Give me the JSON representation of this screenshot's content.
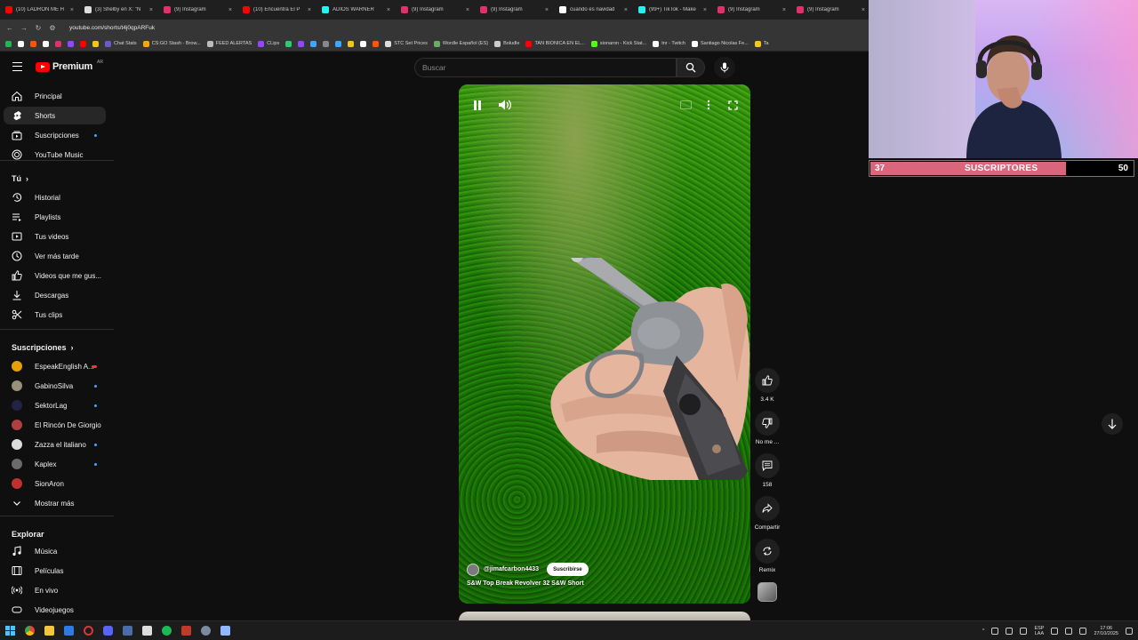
{
  "browser": {
    "tabs": [
      {
        "title": "(10) LADRÓN ME H",
        "color": "#ff0000",
        "active": false
      },
      {
        "title": "(3) Shelby en X: \"N",
        "color": "#dddddd",
        "active": false
      },
      {
        "title": "(9) Instagram",
        "color": "#e1306c",
        "active": false
      },
      {
        "title": "(10) Encuentra El P",
        "color": "#ff0000",
        "active": false
      },
      {
        "title": "ADIOS WARNER",
        "color": "#25f4ee",
        "active": false
      },
      {
        "title": "(9) Instagram",
        "color": "#e1306c",
        "active": false
      },
      {
        "title": "(9) Instagram",
        "color": "#e1306c",
        "active": false
      },
      {
        "title": "cuando es navidad",
        "color": "#ffffff",
        "active": false
      },
      {
        "title": "(99+) TikTok - Make",
        "color": "#25f4ee",
        "active": false
      },
      {
        "title": "(9) Instagram",
        "color": "#e1306c",
        "active": false
      },
      {
        "title": "(9) Instagram",
        "color": "#e1306c",
        "active": false
      }
    ],
    "url": "youtube.com/shorts/t4j0qpARFuk",
    "bookmarks": [
      {
        "label": "",
        "color": "#1db954"
      },
      {
        "label": "",
        "color": "#ffffff"
      },
      {
        "label": "",
        "color": "#ff5500"
      },
      {
        "label": "",
        "color": "#ffffff"
      },
      {
        "label": "",
        "color": "#e1306c"
      },
      {
        "label": "",
        "color": "#9146ff"
      },
      {
        "label": "",
        "color": "#ff0000"
      },
      {
        "label": "",
        "color": "#f5c518"
      },
      {
        "label": "Chat Stats",
        "color": "#6a5acd"
      },
      {
        "label": "CS:GO Stash - Brow...",
        "color": "#ffa500"
      },
      {
        "label": "FEED ALERTAS",
        "color": "#bbbbbb"
      },
      {
        "label": "CLips",
        "color": "#9146ff"
      },
      {
        "label": "",
        "color": "#2ecc71"
      },
      {
        "label": "",
        "color": "#9146ff"
      },
      {
        "label": "",
        "color": "#3ea6ff"
      },
      {
        "label": "",
        "color": "#888888"
      },
      {
        "label": "",
        "color": "#3ea6ff"
      },
      {
        "label": "",
        "color": "#f5c518"
      },
      {
        "label": "",
        "color": "#ffffff"
      },
      {
        "label": "",
        "color": "#ff5500"
      },
      {
        "label": "STC Set Prices",
        "color": "#dddddd"
      },
      {
        "label": "Wordle Español (ES)",
        "color": "#6aaa64"
      },
      {
        "label": "Boludle",
        "color": "#cccccc"
      },
      {
        "label": "TAN BIONICA EN EL...",
        "color": "#ff0000"
      },
      {
        "label": "sionaron - Kick Stat...",
        "color": "#53fc18"
      },
      {
        "label": "tnr - Twitch",
        "color": "#ffffff"
      },
      {
        "label": "Santiago Nicolas Fe...",
        "color": "#ffffff"
      },
      {
        "label": "Ta",
        "color": "#f5c518"
      }
    ]
  },
  "youtube": {
    "logo_text": "Premium",
    "logo_country": "AR",
    "search_placeholder": "Buscar",
    "sidebar": {
      "main": [
        {
          "label": "Principal",
          "icon": "home-icon",
          "active": false
        },
        {
          "label": "Shorts",
          "icon": "shorts-icon",
          "active": true
        },
        {
          "label": "Suscripciones",
          "icon": "subscriptions-icon",
          "active": false,
          "dot": true
        },
        {
          "label": "YouTube Music",
          "icon": "music-icon",
          "active": false
        }
      ],
      "you_heading": "Tú",
      "you": [
        {
          "label": "Historial",
          "icon": "history-icon"
        },
        {
          "label": "Playlists",
          "icon": "playlist-icon"
        },
        {
          "label": "Tus videos",
          "icon": "video-icon"
        },
        {
          "label": "Ver más tarde",
          "icon": "clock-icon"
        },
        {
          "label": "Videos que me gus...",
          "icon": "like-icon"
        },
        {
          "label": "Descargas",
          "icon": "download-icon"
        },
        {
          "label": "Tus clips",
          "icon": "scissors-icon"
        }
      ],
      "subs_heading": "Suscripciones",
      "subs": [
        {
          "label": "EspeakEnglish A...",
          "color": "#e3a008",
          "badge": "live"
        },
        {
          "label": "GabinoSilva",
          "color": "#9a8f7a",
          "badge": "dot"
        },
        {
          "label": "SektorLag",
          "color": "#222244",
          "badge": "dot"
        },
        {
          "label": "El Rincón De Giorgio",
          "color": "#b04040",
          "badge": "none"
        },
        {
          "label": "Zazza el italiano",
          "color": "#dddddd",
          "badge": "dot"
        },
        {
          "label": "Kaplex",
          "color": "#6b6b6b",
          "badge": "dot"
        },
        {
          "label": "SionAron",
          "color": "#c03030",
          "badge": "none"
        }
      ],
      "show_more": "Mostrar más",
      "explore_heading": "Explorar",
      "explore": [
        {
          "label": "Música",
          "icon": "music-note-icon"
        },
        {
          "label": "Películas",
          "icon": "film-icon"
        },
        {
          "label": "En vivo",
          "icon": "live-icon"
        },
        {
          "label": "Videojuegos",
          "icon": "gamepad-icon"
        }
      ]
    },
    "short": {
      "channel": "@jimafcarbon4433",
      "subscribe_label": "Suscribirse",
      "title": "S&W Top Break Revolver 32 S&W Short"
    },
    "actions": {
      "likes": "3.4 K",
      "dislike": "No me ...",
      "comments": "158",
      "share": "Compartir",
      "remix": "Remix"
    }
  },
  "overlay": {
    "current": "37",
    "label": "SUSCRIPTORES",
    "goal": "50",
    "progress": 0.74,
    "fill_color": "#d9667a"
  },
  "tray": {
    "lang_top": "ESP",
    "lang_bottom": "LAA",
    "time": "17:06",
    "date": "27/10/2025"
  }
}
